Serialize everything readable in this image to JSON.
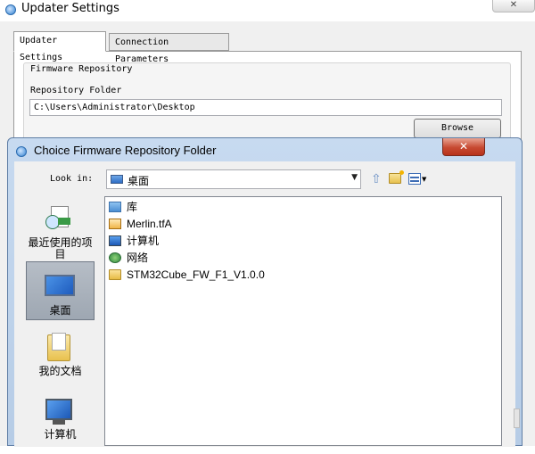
{
  "window": {
    "title": "Updater Settings",
    "close_label": "✕"
  },
  "tabs": [
    {
      "label": "Updater Settings",
      "active": true
    },
    {
      "label": "Connection Parameters",
      "active": false
    }
  ],
  "firmware": {
    "group_title": "Firmware Repository",
    "folder_label": "Repository Folder",
    "folder_value": "C:\\Users\\Administrator\\Desktop",
    "browse_label": "Browse"
  },
  "dialog": {
    "title": "Choice Firmware Repository Folder",
    "close_label": "✕",
    "look_in_label": "Look in:",
    "look_in_value": "桌面",
    "places": [
      {
        "label": "最近使用的项目",
        "icon": "recent-items-icon"
      },
      {
        "label": "桌面",
        "icon": "desktop-icon",
        "selected": true
      },
      {
        "label": "我的文档",
        "icon": "documents-icon"
      },
      {
        "label": "计算机",
        "icon": "computer-icon"
      }
    ],
    "files": [
      {
        "name": "库",
        "icon": "libraries-icon"
      },
      {
        "name": "Merlin.tfA",
        "icon": "file-icon"
      },
      {
        "name": "计算机",
        "icon": "computer-icon"
      },
      {
        "name": "网络",
        "icon": "network-icon"
      },
      {
        "name": "STM32Cube_FW_F1_V1.0.0",
        "icon": "folder-icon"
      }
    ]
  },
  "colors": {
    "dialog_frame": "#b6cce6",
    "close_red": "#c74a32",
    "selection": "#9ea7b2"
  }
}
